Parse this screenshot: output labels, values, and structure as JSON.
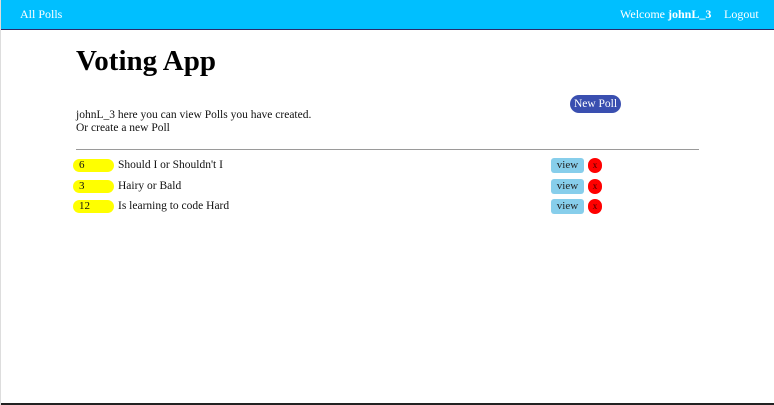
{
  "navbar": {
    "brand_label": "All Polls",
    "welcome_prefix": "Welcome",
    "username": "johnL_3",
    "logout_label": "Logout"
  },
  "page": {
    "title": "Voting App",
    "intro_line1": "johnL_3 here you can view Polls you have created.",
    "intro_line2": "Or create a new Poll",
    "new_poll_label": "New Poll"
  },
  "polls": [
    {
      "votes": "6",
      "question": "Should I or Shouldn't I",
      "view_label": "view",
      "delete_label": "x"
    },
    {
      "votes": "3",
      "question": "Hairy or Bald",
      "view_label": "view",
      "delete_label": "x"
    },
    {
      "votes": "12",
      "question": "Is learning to code Hard",
      "view_label": "view",
      "delete_label": "x"
    }
  ],
  "colors": {
    "navbar": "#00bfff",
    "new_poll_button": "#3a4fb0",
    "vote_badge": "#ffff00",
    "view_button": "#87ceeb",
    "delete_button": "#ff0000"
  }
}
